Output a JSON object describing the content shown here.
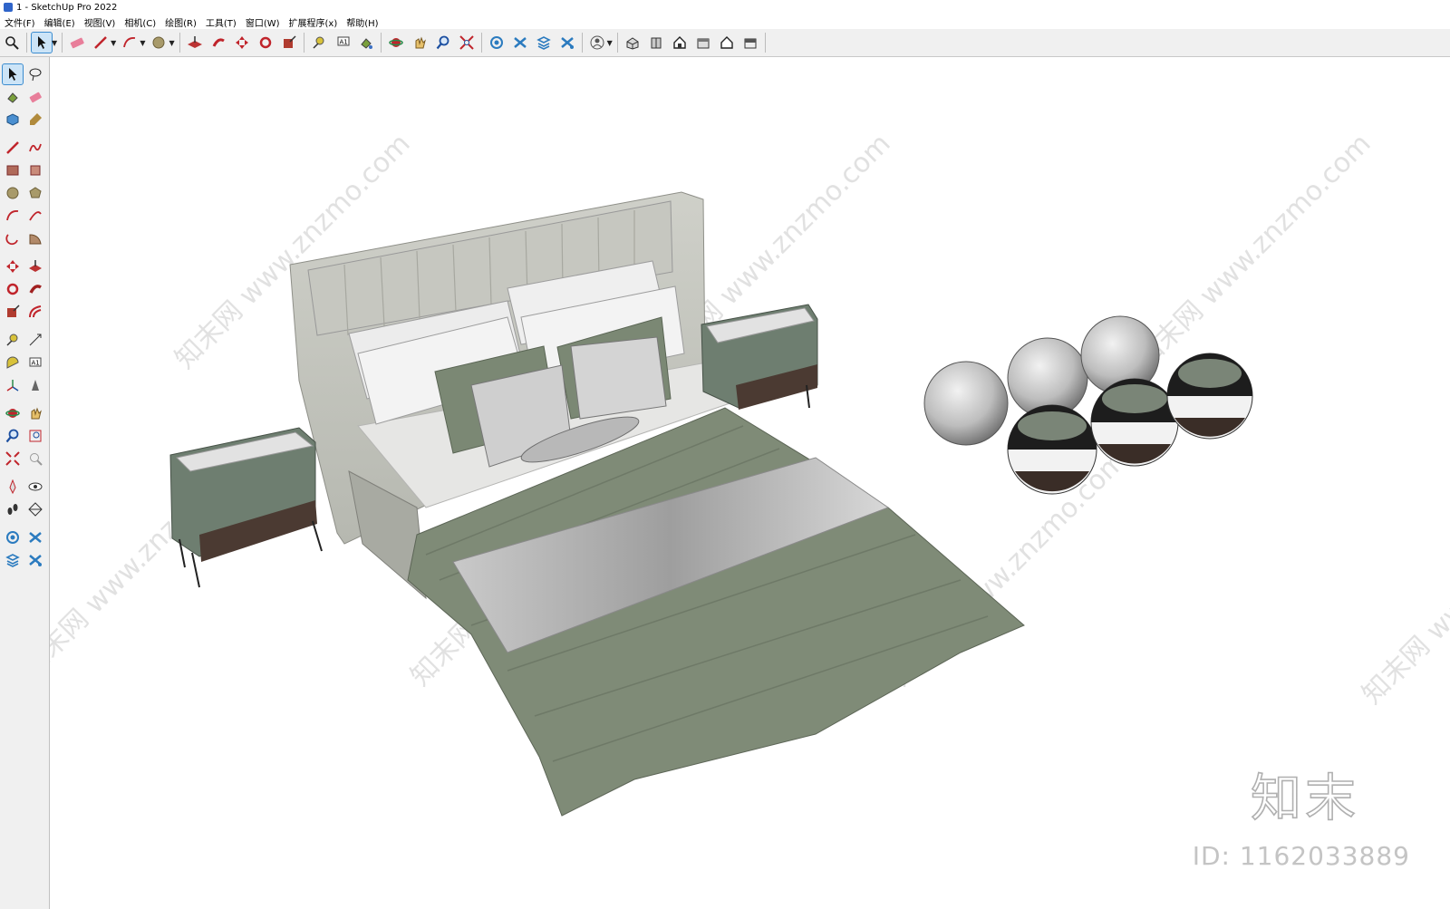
{
  "window": {
    "title": "1 - SketchUp Pro 2022"
  },
  "menu": [
    {
      "label": "文件(F)"
    },
    {
      "label": "编辑(E)"
    },
    {
      "label": "视图(V)"
    },
    {
      "label": "相机(C)"
    },
    {
      "label": "绘图(R)"
    },
    {
      "label": "工具(T)"
    },
    {
      "label": "窗口(W)"
    },
    {
      "label": "扩展程序(x)"
    },
    {
      "label": "帮助(H)"
    }
  ],
  "overlay": {
    "id_text": "ID: 1162033889",
    "logo": "知末",
    "watermark": "知末网 www.znzmo.com"
  },
  "colors": {
    "accent": "#3c8dd0",
    "bed_green": "#7f8b77",
    "headboard": "#c3c4bd",
    "nightstand": "#6e7e70"
  }
}
